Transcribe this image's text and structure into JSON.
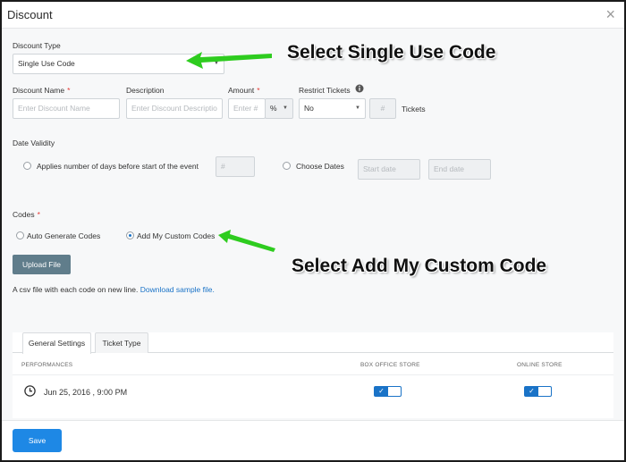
{
  "dialog": {
    "title": "Discount",
    "close_glyph": "×"
  },
  "discount_type": {
    "label": "Discount Type",
    "value": "Single Use Code"
  },
  "fields": {
    "name": {
      "label": "Discount Name",
      "placeholder": "Enter Discount Name"
    },
    "description": {
      "label": "Description",
      "placeholder": "Enter Discount Descriptio"
    },
    "amount": {
      "label": "Amount",
      "placeholder": "Enter #",
      "unit": "%"
    },
    "restrict": {
      "label": "Restrict Tickets",
      "value": "No",
      "count_placeholder": "#",
      "suffix": "Tickets"
    }
  },
  "date_validity": {
    "label": "Date Validity",
    "option_days": "Applies number of days before start of the event",
    "days_placeholder": "#",
    "option_dates": "Choose Dates",
    "start_placeholder": "Start date",
    "end_placeholder": "End date"
  },
  "codes": {
    "label": "Codes",
    "option_auto": "Auto Generate Codes",
    "option_custom": "Add My Custom Codes",
    "selected": "custom"
  },
  "upload": {
    "button": "Upload File",
    "hint": "A csv file with each code on new line.",
    "link": "Download sample file."
  },
  "tabs": [
    {
      "label": "General Settings",
      "active": true
    },
    {
      "label": "Ticket Type",
      "active": false
    }
  ],
  "table": {
    "headers": [
      "PERFORMANCES",
      "BOX OFFICE STORE",
      "ONLINE STORE"
    ],
    "rows": [
      {
        "performance": "Jun 25, 2016 , 9:00 PM",
        "box_office": true,
        "online": true
      }
    ]
  },
  "footer": {
    "save": "Save"
  },
  "annotations": {
    "callout_1": "Select Single Use Code",
    "callout_2": "Select Add My Custom Code",
    "arrow_color": "#2ecc1f"
  },
  "colors": {
    "primary": "#1e88e5",
    "upload_button": "#607d8b",
    "required": "#e53935"
  },
  "icons": {
    "info": "info-icon",
    "clock": "clock-icon",
    "close": "close-icon",
    "check": "check-icon"
  }
}
